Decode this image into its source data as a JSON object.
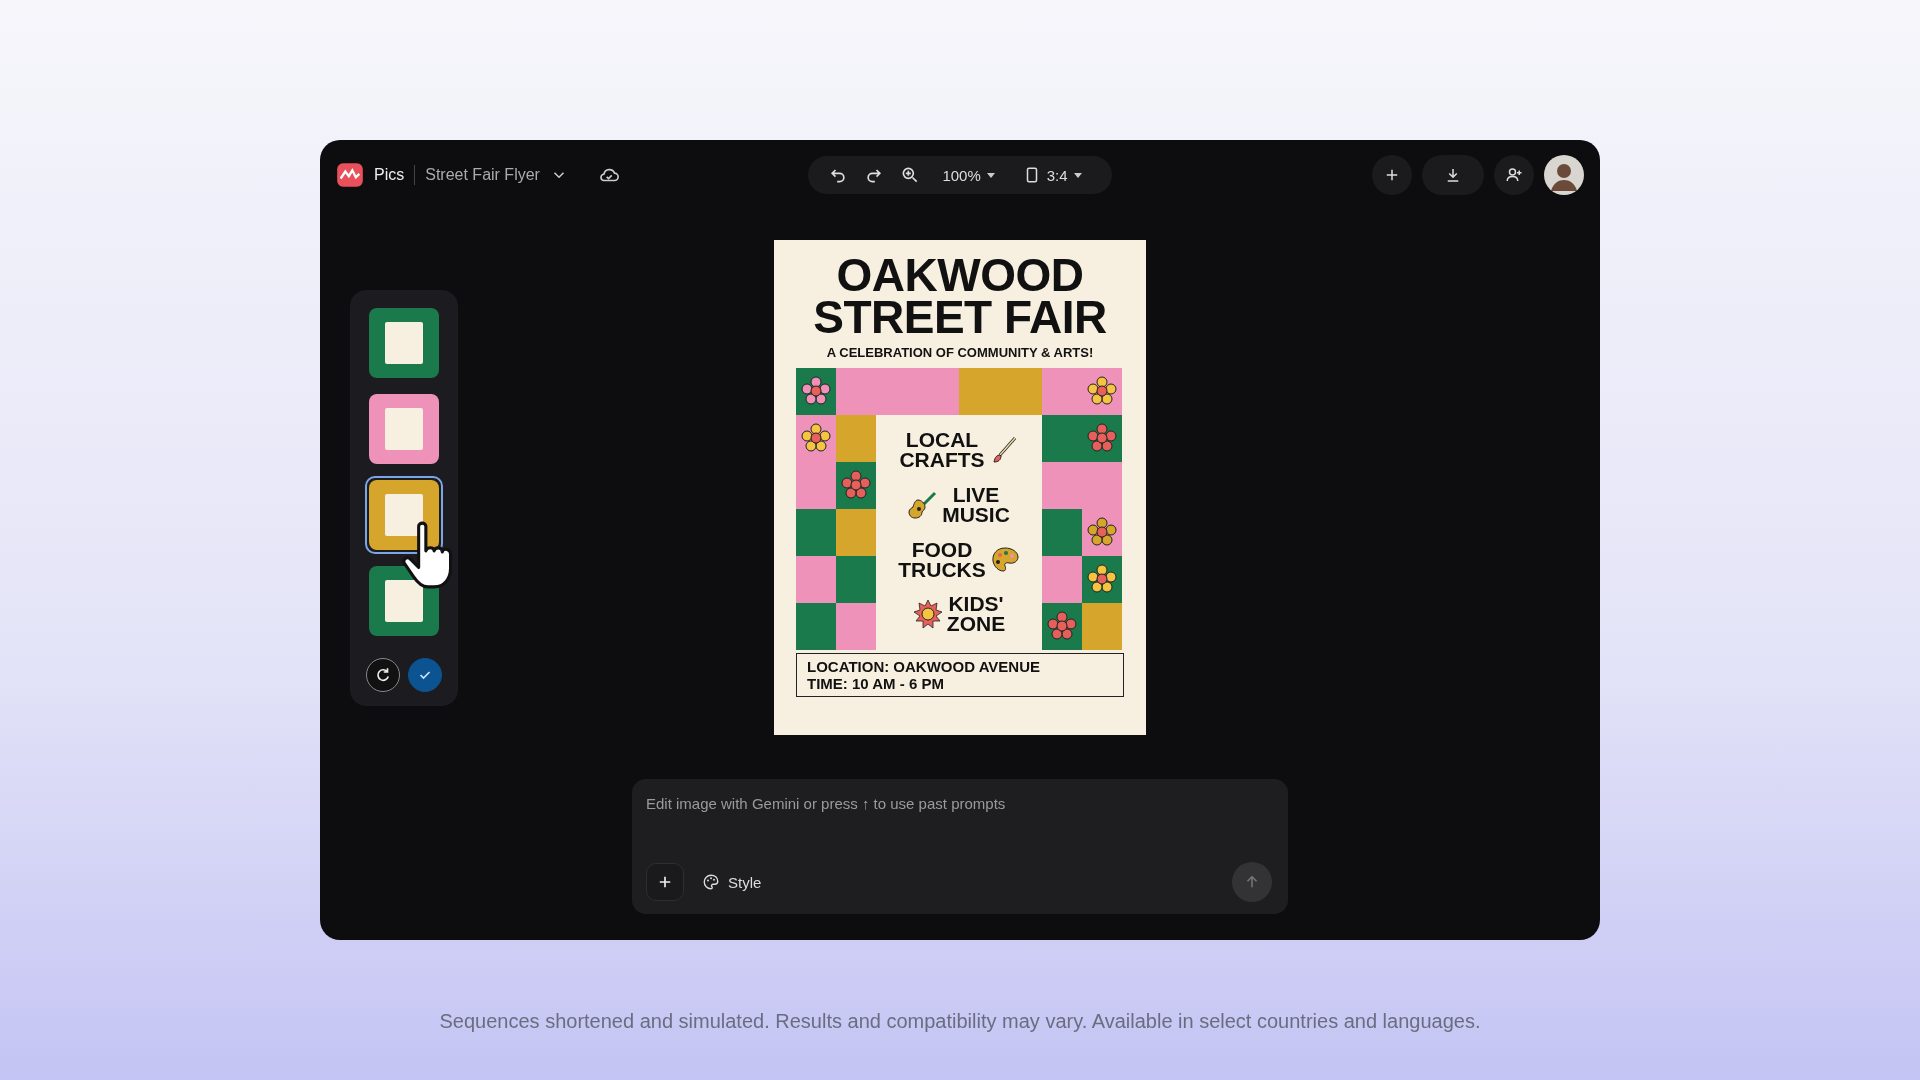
{
  "app": {
    "name": "Pics",
    "document_title": "Street Fair Flyer"
  },
  "toolbar": {
    "zoom": "100%",
    "aspect": "3:4"
  },
  "thumbnails": [
    {
      "selected": false
    },
    {
      "selected": false
    },
    {
      "selected": true
    },
    {
      "selected": false
    }
  ],
  "poster": {
    "title_lines": [
      "OAKWOOD",
      "STREET FAIR"
    ],
    "subtitle": "A CELEBRATION OF COMMUNITY & ARTS!",
    "activities": [
      {
        "text": "LOCAL\nCRAFTS"
      },
      {
        "text": "LIVE\nMUSIC"
      },
      {
        "text": "FOOD\nTRUCKS"
      },
      {
        "text": "KIDS'\nZONE"
      }
    ],
    "location": "LOCATION: OAKWOOD AVENUE",
    "time": "TIME: 10 AM - 6 PM"
  },
  "prompt": {
    "placeholder": "Edit image with Gemini or press ↑ to use past prompts",
    "style_label": "Style",
    "send_disabled": true
  },
  "footnote": "Sequences shortened and simulated. Results and compatibility may vary. Available in select countries and languages."
}
